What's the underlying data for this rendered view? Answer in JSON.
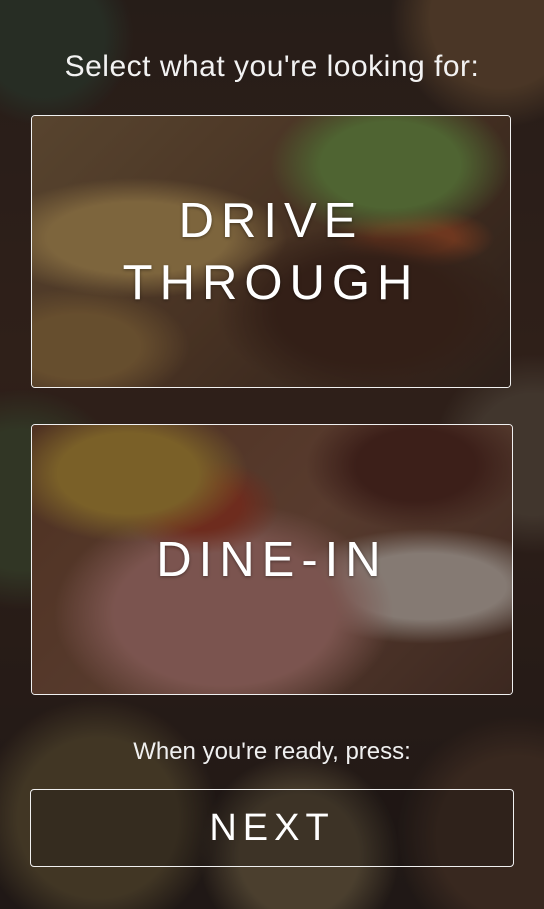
{
  "heading": "Select what you're looking for:",
  "options": [
    {
      "label": "DRIVE THROUGH"
    },
    {
      "label": "DINE-IN"
    }
  ],
  "ready_prompt": "When you're ready, press:",
  "next_label": "NEXT"
}
